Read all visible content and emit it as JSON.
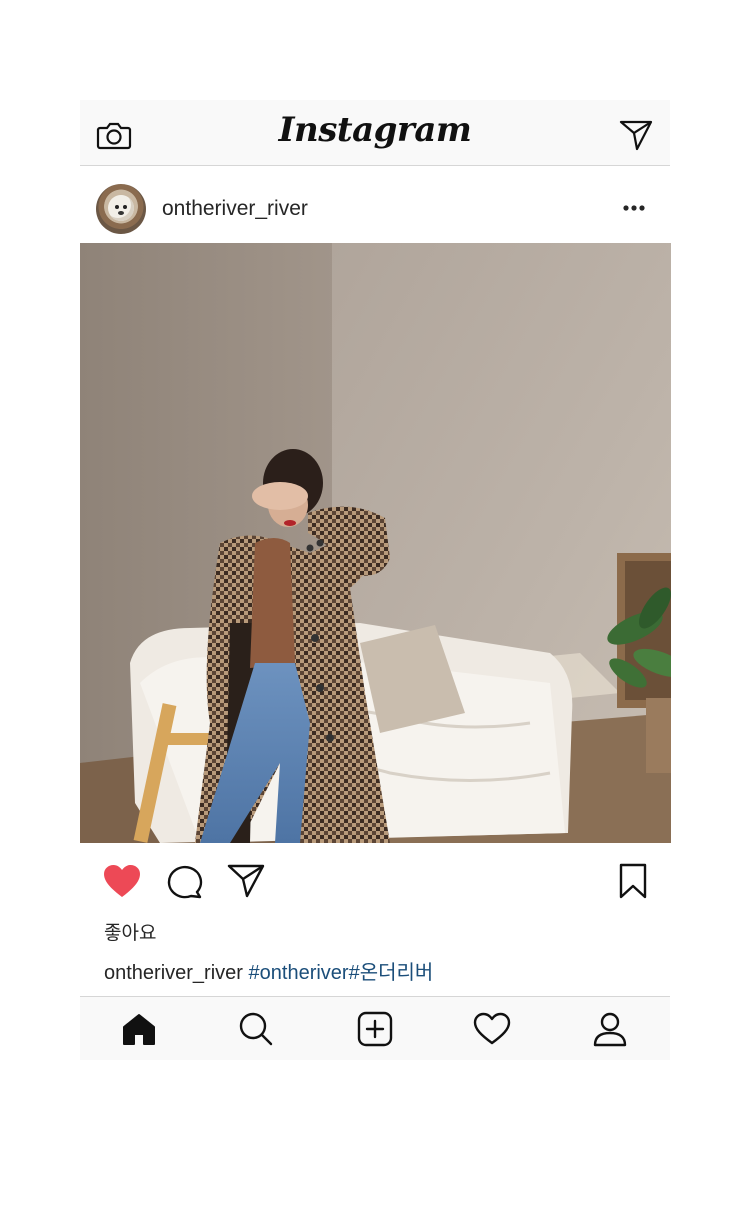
{
  "app": {
    "title": "Instagram"
  },
  "post": {
    "username": "ontheriver_river",
    "likes_label": "좋아요",
    "caption_user": "ontheriver_river",
    "caption_tags": "#ontheriver#온더리버",
    "liked": true
  },
  "icons": {
    "topbar": [
      "camera-icon",
      "direct-message-icon"
    ],
    "post_header": [
      "more-options-icon"
    ],
    "actions": [
      "heart-filled-icon",
      "comment-icon",
      "share-icon",
      "bookmark-icon"
    ],
    "bottom_nav": [
      "home-icon",
      "search-icon",
      "add-post-icon",
      "activity-heart-icon",
      "profile-icon"
    ]
  },
  "colors": {
    "like_red": "#ed4956",
    "hashtag_blue": "#1b4e7a",
    "bar_background": "#f9f9f9",
    "text": "#262626"
  }
}
